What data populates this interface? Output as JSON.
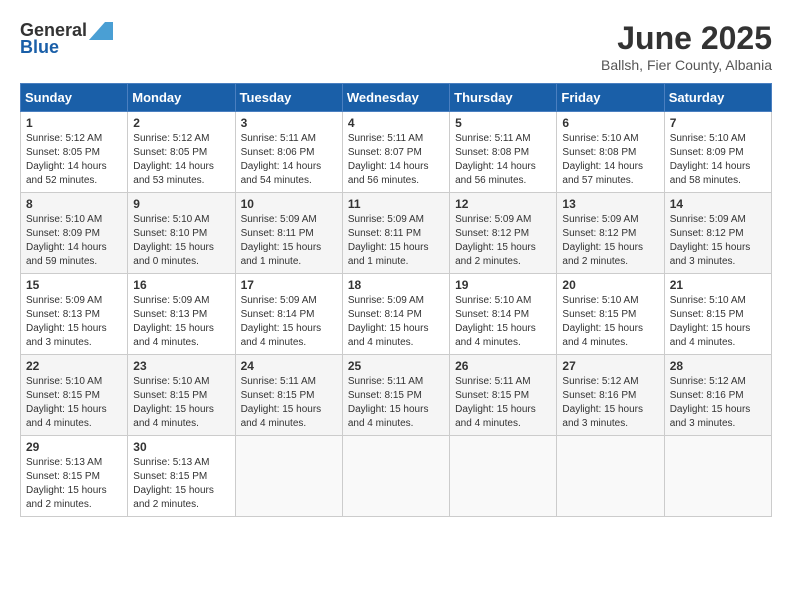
{
  "header": {
    "logo_general": "General",
    "logo_blue": "Blue",
    "month_title": "June 2025",
    "location": "Ballsh, Fier County, Albania"
  },
  "weekdays": [
    "Sunday",
    "Monday",
    "Tuesday",
    "Wednesday",
    "Thursday",
    "Friday",
    "Saturday"
  ],
  "weeks": [
    [
      {
        "day": "1",
        "sunrise": "5:12 AM",
        "sunset": "8:05 PM",
        "daylight": "14 hours and 52 minutes."
      },
      {
        "day": "2",
        "sunrise": "5:12 AM",
        "sunset": "8:05 PM",
        "daylight": "14 hours and 53 minutes."
      },
      {
        "day": "3",
        "sunrise": "5:11 AM",
        "sunset": "8:06 PM",
        "daylight": "14 hours and 54 minutes."
      },
      {
        "day": "4",
        "sunrise": "5:11 AM",
        "sunset": "8:07 PM",
        "daylight": "14 hours and 56 minutes."
      },
      {
        "day": "5",
        "sunrise": "5:11 AM",
        "sunset": "8:08 PM",
        "daylight": "14 hours and 56 minutes."
      },
      {
        "day": "6",
        "sunrise": "5:10 AM",
        "sunset": "8:08 PM",
        "daylight": "14 hours and 57 minutes."
      },
      {
        "day": "7",
        "sunrise": "5:10 AM",
        "sunset": "8:09 PM",
        "daylight": "14 hours and 58 minutes."
      }
    ],
    [
      {
        "day": "8",
        "sunrise": "5:10 AM",
        "sunset": "8:09 PM",
        "daylight": "14 hours and 59 minutes."
      },
      {
        "day": "9",
        "sunrise": "5:10 AM",
        "sunset": "8:10 PM",
        "daylight": "15 hours and 0 minutes."
      },
      {
        "day": "10",
        "sunrise": "5:09 AM",
        "sunset": "8:11 PM",
        "daylight": "15 hours and 1 minute."
      },
      {
        "day": "11",
        "sunrise": "5:09 AM",
        "sunset": "8:11 PM",
        "daylight": "15 hours and 1 minute."
      },
      {
        "day": "12",
        "sunrise": "5:09 AM",
        "sunset": "8:12 PM",
        "daylight": "15 hours and 2 minutes."
      },
      {
        "day": "13",
        "sunrise": "5:09 AM",
        "sunset": "8:12 PM",
        "daylight": "15 hours and 2 minutes."
      },
      {
        "day": "14",
        "sunrise": "5:09 AM",
        "sunset": "8:12 PM",
        "daylight": "15 hours and 3 minutes."
      }
    ],
    [
      {
        "day": "15",
        "sunrise": "5:09 AM",
        "sunset": "8:13 PM",
        "daylight": "15 hours and 3 minutes."
      },
      {
        "day": "16",
        "sunrise": "5:09 AM",
        "sunset": "8:13 PM",
        "daylight": "15 hours and 4 minutes."
      },
      {
        "day": "17",
        "sunrise": "5:09 AM",
        "sunset": "8:14 PM",
        "daylight": "15 hours and 4 minutes."
      },
      {
        "day": "18",
        "sunrise": "5:09 AM",
        "sunset": "8:14 PM",
        "daylight": "15 hours and 4 minutes."
      },
      {
        "day": "19",
        "sunrise": "5:10 AM",
        "sunset": "8:14 PM",
        "daylight": "15 hours and 4 minutes."
      },
      {
        "day": "20",
        "sunrise": "5:10 AM",
        "sunset": "8:15 PM",
        "daylight": "15 hours and 4 minutes."
      },
      {
        "day": "21",
        "sunrise": "5:10 AM",
        "sunset": "8:15 PM",
        "daylight": "15 hours and 4 minutes."
      }
    ],
    [
      {
        "day": "22",
        "sunrise": "5:10 AM",
        "sunset": "8:15 PM",
        "daylight": "15 hours and 4 minutes."
      },
      {
        "day": "23",
        "sunrise": "5:10 AM",
        "sunset": "8:15 PM",
        "daylight": "15 hours and 4 minutes."
      },
      {
        "day": "24",
        "sunrise": "5:11 AM",
        "sunset": "8:15 PM",
        "daylight": "15 hours and 4 minutes."
      },
      {
        "day": "25",
        "sunrise": "5:11 AM",
        "sunset": "8:15 PM",
        "daylight": "15 hours and 4 minutes."
      },
      {
        "day": "26",
        "sunrise": "5:11 AM",
        "sunset": "8:15 PM",
        "daylight": "15 hours and 4 minutes."
      },
      {
        "day": "27",
        "sunrise": "5:12 AM",
        "sunset": "8:16 PM",
        "daylight": "15 hours and 3 minutes."
      },
      {
        "day": "28",
        "sunrise": "5:12 AM",
        "sunset": "8:16 PM",
        "daylight": "15 hours and 3 minutes."
      }
    ],
    [
      {
        "day": "29",
        "sunrise": "5:13 AM",
        "sunset": "8:15 PM",
        "daylight": "15 hours and 2 minutes."
      },
      {
        "day": "30",
        "sunrise": "5:13 AM",
        "sunset": "8:15 PM",
        "daylight": "15 hours and 2 minutes."
      },
      null,
      null,
      null,
      null,
      null
    ]
  ]
}
